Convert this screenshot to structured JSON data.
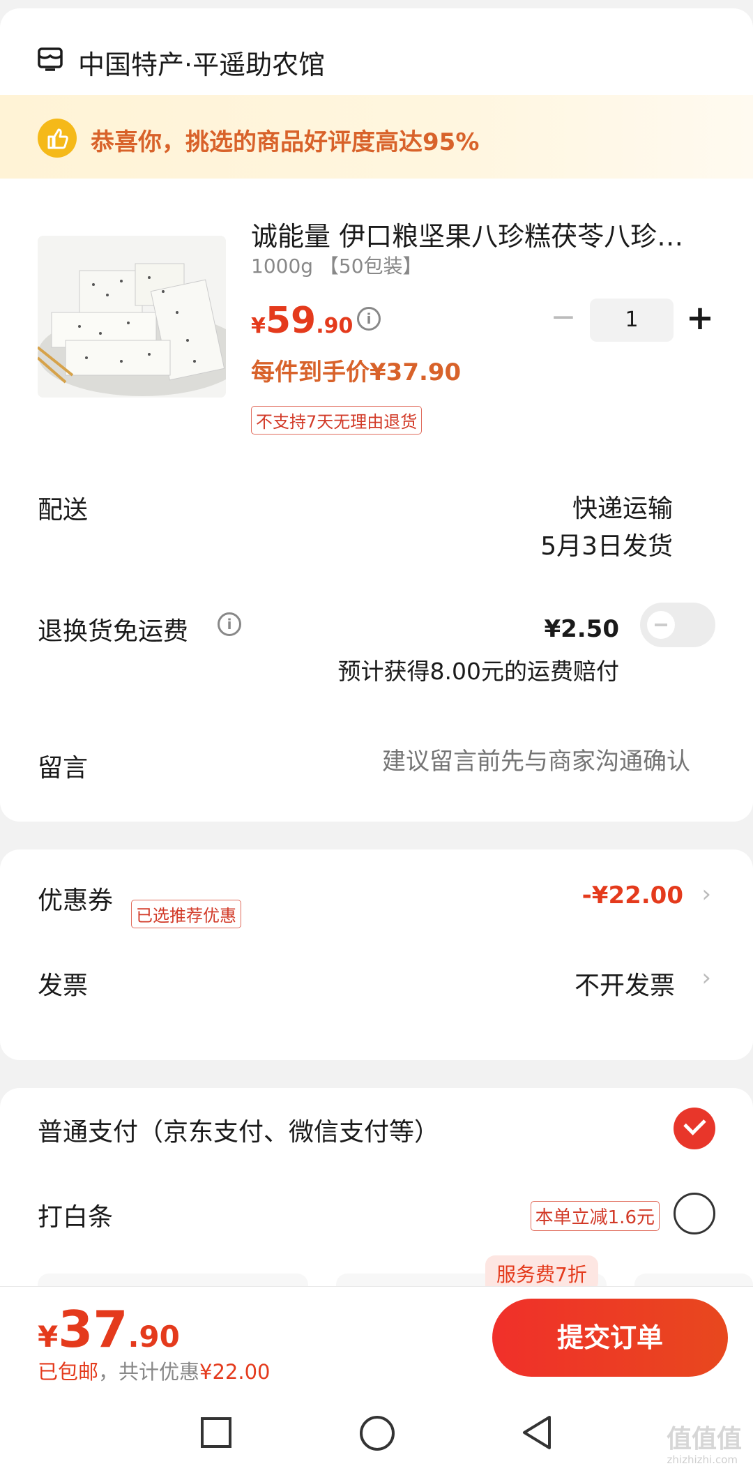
{
  "store": {
    "name": "中国特产·平遥助农馆",
    "icon": "store-icon"
  },
  "banner": {
    "text": "恭喜你，挑选的商品好评度高达95%",
    "icon": "thumbs-up-icon",
    "accent": "#f5b919"
  },
  "product": {
    "title": "诚能量 伊口粮坚果八珍糕茯苓八珍…",
    "spec": "1000g 【50包装】",
    "price_symbol": "¥",
    "price_int": "59",
    "price_dec": ".90",
    "each_price": "每件到手价¥37.90",
    "quantity": "1",
    "minus": "−",
    "plus": "+",
    "no_return_tag": "不支持7天无理由退货"
  },
  "delivery": {
    "label": "配送",
    "method": "快递运输",
    "date": "5月3日发货"
  },
  "return_insurance": {
    "label": "退换货免运费",
    "price": "¥2.50",
    "note": "预计获得8.00元的运费赔付",
    "enabled": false
  },
  "message": {
    "label": "留言",
    "placeholder": "建议留言前先与商家沟通确认"
  },
  "coupon": {
    "label": "优惠券",
    "tag": "已选推荐优惠",
    "value": "-¥22.00",
    "chevron": "›"
  },
  "invoice": {
    "label": "发票",
    "value": "不开发票",
    "chevron": "›"
  },
  "payment": {
    "normal_label": "普通支付（京东支付、微信支付等）",
    "normal_selected": true,
    "baitiao_label": "打白条",
    "baitiao_tag": "本单立减1.6元",
    "baitiao_selected": false,
    "service_fee_tag": "服务费7折"
  },
  "footer": {
    "total_symbol": "¥",
    "total_int": "37",
    "total_dec": ".90",
    "shipping": "已包邮",
    "savings_prefix": "，共计优惠",
    "savings_value": "¥22.00",
    "submit_label": "提交订单"
  },
  "nav": {
    "recent": "square-icon",
    "home": "circle-icon",
    "back": "triangle-back-icon"
  },
  "watermark": {
    "text": "值值值",
    "sub": "zhizhizhi.com"
  },
  "colors": {
    "accent_red": "#e43a1c",
    "brand_orange": "#d8622a"
  }
}
